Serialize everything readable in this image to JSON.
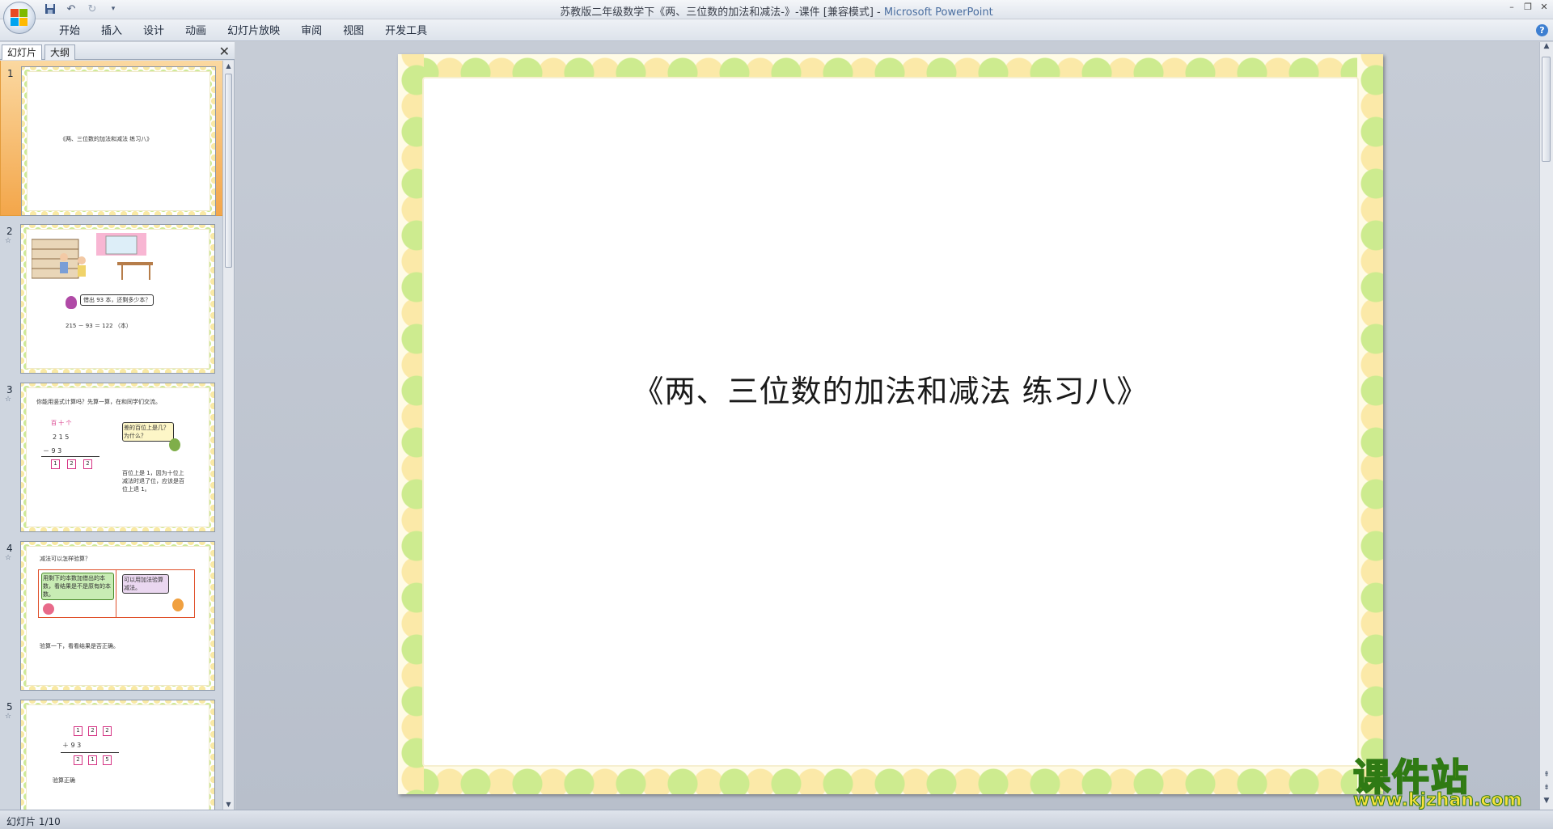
{
  "window": {
    "title_doc": "苏教版二年级数学下《两、三位数的加法和减法-》-课件 [兼容模式] - ",
    "title_app": "Microsoft PowerPoint"
  },
  "qat": {
    "save_icon": "save-icon",
    "undo_icon": "undo-icon",
    "redo_icon": "redo-icon",
    "customize_icon": "dropdown-icon"
  },
  "ribbon": {
    "tabs": [
      "开始",
      "插入",
      "设计",
      "动画",
      "幻灯片放映",
      "审阅",
      "视图",
      "开发工具"
    ]
  },
  "panel": {
    "tab_slides": "幻灯片",
    "tab_outline": "大纲",
    "close": "✕"
  },
  "thumbnails": [
    {
      "num": "1",
      "title": "《两、三位数的加法和减法 练习八》"
    },
    {
      "num": "2",
      "speech": "借出 93 本，还剩多少本？",
      "equation": "215 － 93 ＝  122 （本）"
    },
    {
      "num": "3",
      "question": "你能用竖式计算吗？先算一算，在和同学们交流。",
      "header": "百   十   个",
      "row1": "2     1     5",
      "row2": "－        9     3",
      "ans": [
        "1",
        "2",
        "2"
      ],
      "bubble": "差的百位上是几？为什么？",
      "note": "百位上是 1，因为十位上减法时退了位，应该是百位上退 1。"
    },
    {
      "num": "4",
      "question": "减法可以怎样验算？",
      "left_bubble": "用剩下的本数加借出的本数，看结果是不是原有的本数。",
      "right_bubble": "可以用加法验算减法。",
      "footer": "验算一下，看看结果是否正确。"
    },
    {
      "num": "5",
      "top": [
        "1",
        "2",
        "2"
      ],
      "middle": "＋        9     3",
      "bottom": [
        "2",
        "1",
        "5"
      ],
      "footer": "验算正确"
    }
  ],
  "slide": {
    "title": "《两、三位数的加法和减法 练习八》"
  },
  "status": {
    "slide_info": "幻灯片 1/10"
  },
  "watermark": {
    "cn": "课件站",
    "url": "www.kjzhan.com"
  },
  "colors": {
    "accent": "#f3a64a",
    "dot_green": "#cdeb8f",
    "dot_yellow": "#fbe9a8",
    "dot_peach": "#f7ceb0"
  }
}
